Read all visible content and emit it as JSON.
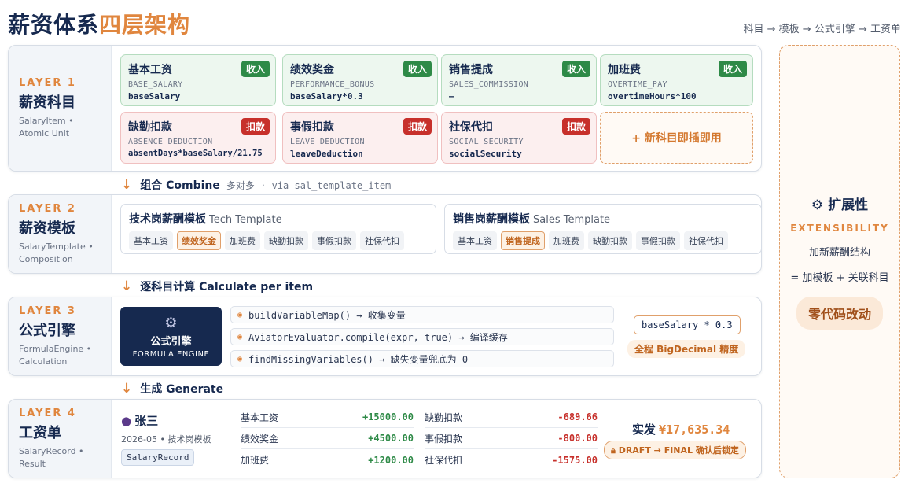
{
  "header": {
    "title_main": "薪资体系",
    "title_accent": "四层架构",
    "subtitle": "科目 → 模板 → 公式引擎 → 工资单"
  },
  "layer1": {
    "tag": "LAYER 1",
    "name": "薪资科目",
    "desc1": "SalaryItem •",
    "desc2": "Atomic Unit",
    "items": [
      {
        "name": "基本工资",
        "code": "BASE_SALARY",
        "formula": "baseSalary",
        "badge": "收入",
        "kind": "income"
      },
      {
        "name": "绩效奖金",
        "code": "PERFORMANCE_BONUS",
        "formula": "baseSalary*0.3",
        "badge": "收入",
        "kind": "income"
      },
      {
        "name": "销售提成",
        "code": "SALES_COMMISSION",
        "formula": "—",
        "badge": "收入",
        "kind": "income"
      },
      {
        "name": "加班费",
        "code": "OVERTIME_PAY",
        "formula": "overtimeHours*100",
        "badge": "收入",
        "kind": "income"
      },
      {
        "name": "缺勤扣款",
        "code": "ABSENCE_DEDUCTION",
        "formula": "absentDays*baseSalary/21.75",
        "badge": "扣款",
        "kind": "deduct"
      },
      {
        "name": "事假扣款",
        "code": "LEAVE_DEDUCTION",
        "formula": "leaveDeduction",
        "badge": "扣款",
        "kind": "deduct"
      },
      {
        "name": "社保代扣",
        "code": "SOCIAL_SECURITY",
        "formula": "socialSecurity",
        "badge": "扣款",
        "kind": "deduct"
      }
    ],
    "new_item": "+ 新科目即插即用"
  },
  "connector1": {
    "arrow": "↓",
    "label": "组合 Combine",
    "note": "多对多 · via sal_template_item"
  },
  "layer2": {
    "tag": "LAYER 2",
    "name": "薪资模板",
    "desc1": "SalaryTemplate •",
    "desc2": "Composition",
    "templates": [
      {
        "title": "技术岗薪酬模板",
        "en": "Tech Template",
        "chips": [
          "基本工资",
          "绩效奖金",
          "加班费",
          "缺勤扣款",
          "事假扣款",
          "社保代扣"
        ]
      },
      {
        "title": "销售岗薪酬模板",
        "en": "Sales Template",
        "chips": [
          "基本工资",
          "销售提成",
          "加班费",
          "缺勤扣款",
          "事假扣款",
          "社保代扣"
        ]
      }
    ]
  },
  "connector2": {
    "arrow": "↓",
    "label": "逐科目计算 Calculate per item"
  },
  "layer3": {
    "tag": "LAYER 3",
    "name": "公式引擎",
    "desc1": "FormulaEngine •",
    "desc2": "Calculation",
    "engine_cn": "公式引擎",
    "engine_en": "FORMULA ENGINE",
    "steps": [
      "buildVariableMap() → 收集变量",
      "AviatorEvaluator.compile(expr, true) → 编译缓存",
      "findMissingVariables() → 缺失变量兜底为 0"
    ],
    "expression": "baseSalary * 0.3",
    "precision": "全程 BigDecimal 精度"
  },
  "connector3": {
    "arrow": "↓",
    "label": "生成 Generate"
  },
  "layer4": {
    "tag": "LAYER 4",
    "name": "工资单",
    "desc1": "SalaryRecord •",
    "desc2": "Result",
    "person": "张三",
    "period": "2026-05 • 技术岗模板",
    "record_tag": "SalaryRecord",
    "income_lines": [
      {
        "label": "基本工资",
        "value": "+15000.00"
      },
      {
        "label": "绩效奖金",
        "value": "+4500.00"
      },
      {
        "label": "加班费",
        "value": "+1200.00"
      }
    ],
    "deduct_lines": [
      {
        "label": "缺勤扣款",
        "value": "-689.66"
      },
      {
        "label": "事假扣款",
        "value": "-800.00"
      },
      {
        "label": "社保代扣",
        "value": "-1575.00"
      }
    ],
    "net_label": "实发",
    "net_amount": "¥17,635.34",
    "lock_label": "DRAFT → FINAL 确认后锁定"
  },
  "extensibility": {
    "title": "扩展性",
    "en": "EXTENSIBILITY",
    "line1": "加新薪酬结构",
    "line2": "= 加模板 + 关联科目",
    "pill": "零代码改动"
  },
  "colors": {
    "navy": "#16294f",
    "accent": "#e0863e",
    "income": "#2e8a47",
    "deduct": "#c7302b"
  }
}
